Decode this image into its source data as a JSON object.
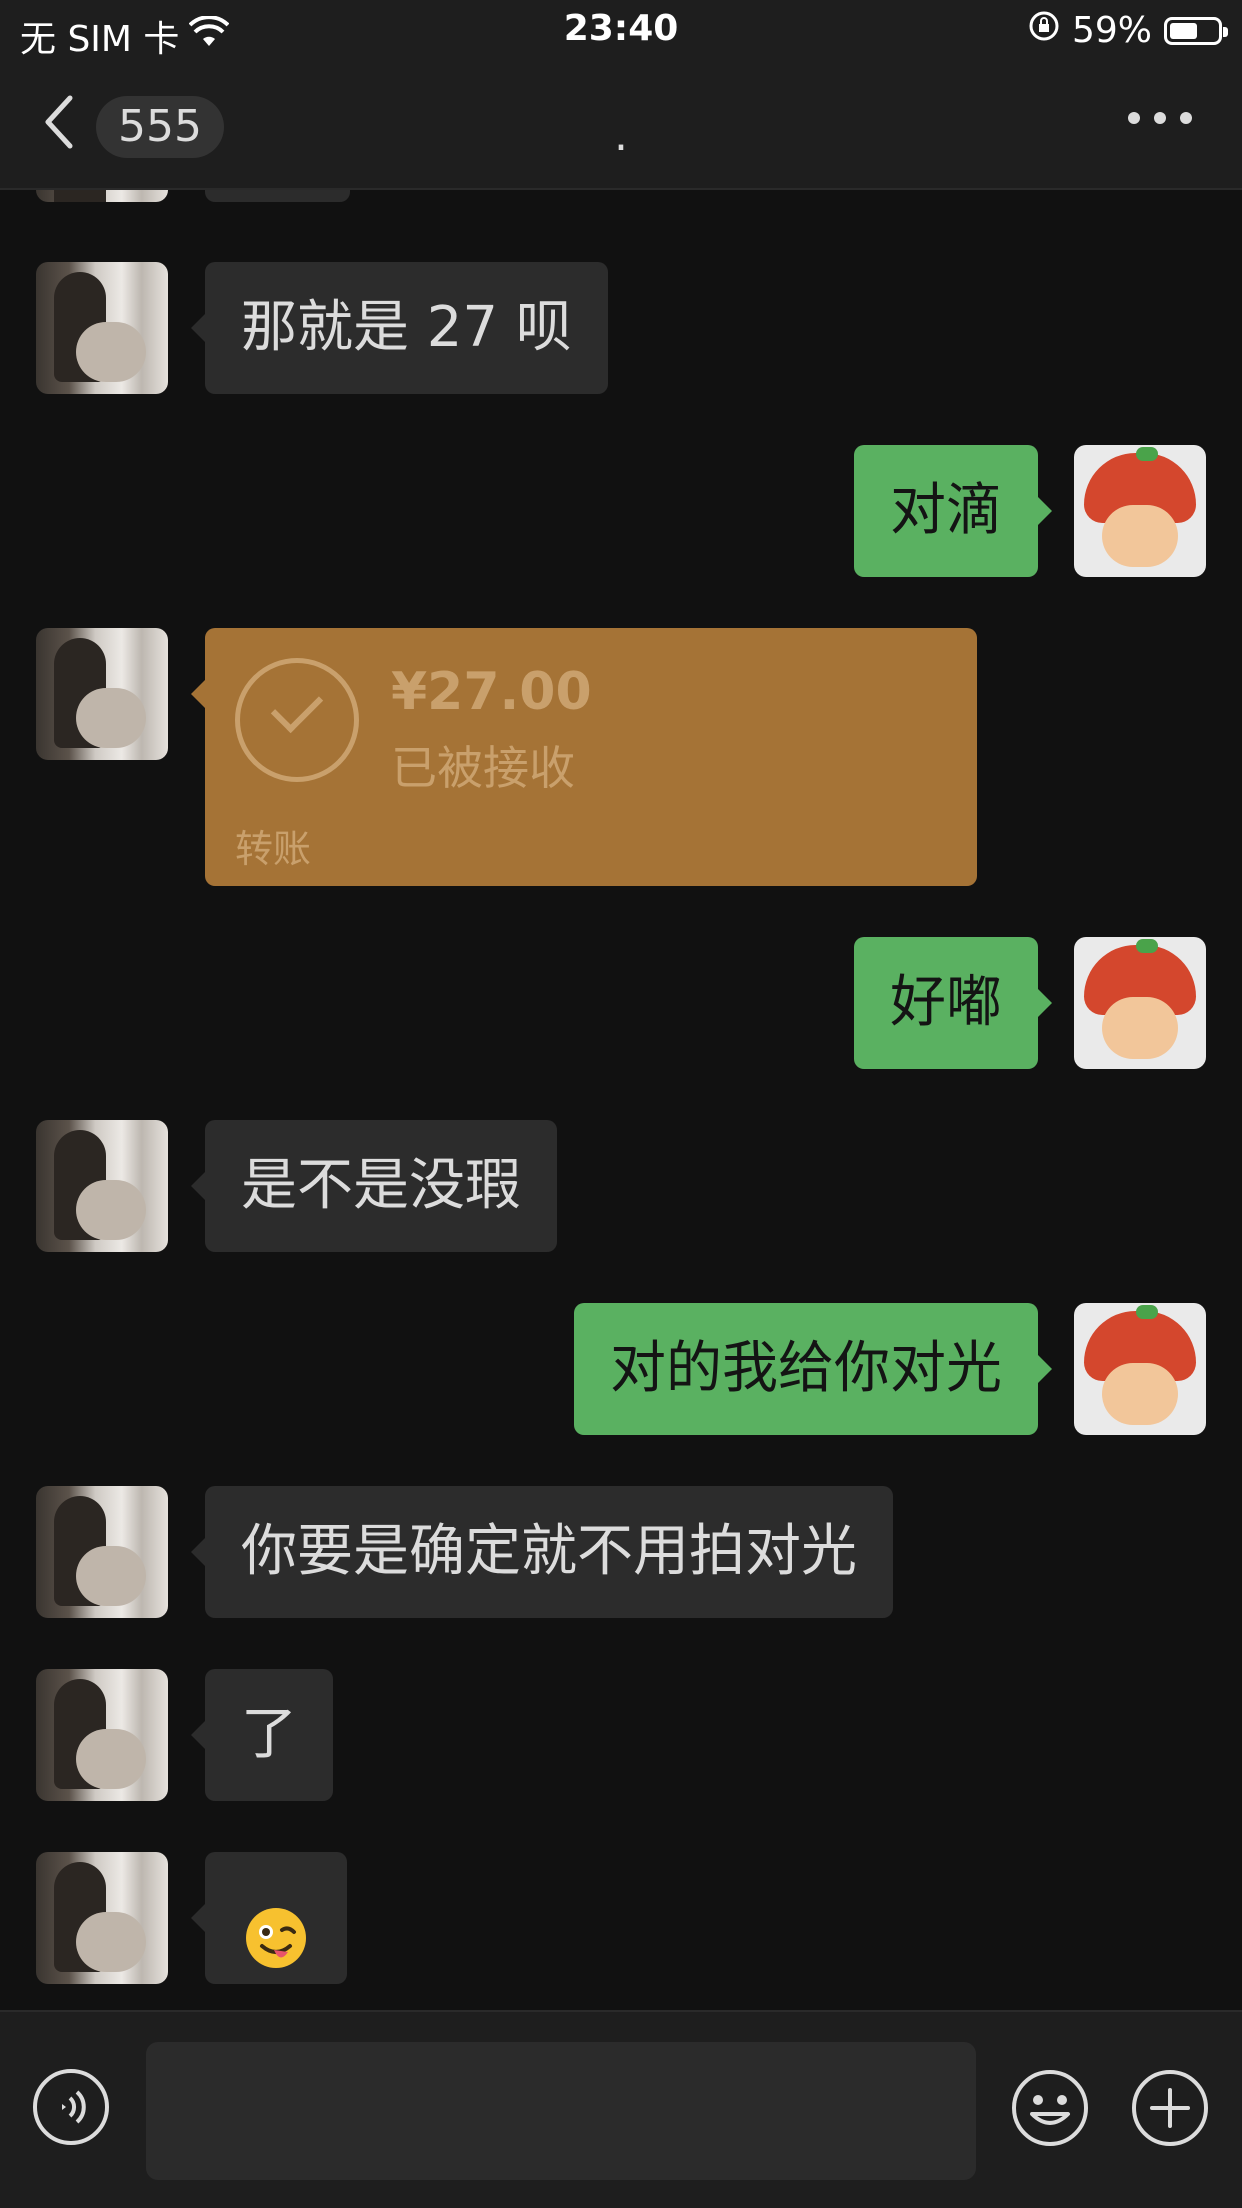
{
  "status_bar": {
    "carrier": "无 SIM 卡",
    "time": "23:40",
    "battery_percent": "59%",
    "battery_level": 0.59
  },
  "nav": {
    "unread_count": "555",
    "title": "."
  },
  "messages": [
    {
      "side": "in",
      "text": "那就是 27 呗"
    },
    {
      "side": "out",
      "text": "对滴"
    },
    {
      "side": "in",
      "type": "transfer",
      "amount": "¥27.00",
      "status": "已被接收",
      "label": "转账"
    },
    {
      "side": "out",
      "text": "好嘟"
    },
    {
      "side": "in",
      "text": "是不是没瑕"
    },
    {
      "side": "out",
      "text": "对的我给你对光"
    },
    {
      "side": "in",
      "text": "你要是确定就不用拍对光"
    },
    {
      "side": "in",
      "text": "了"
    },
    {
      "side": "in",
      "type": "emoji",
      "emoji": "winking-face-with-tongue"
    }
  ],
  "colors": {
    "background": "#111111",
    "bar": "#1e1e1e",
    "incoming_bubble": "#2c2c2c",
    "outgoing_bubble": "#5ab161",
    "transfer_card": "#a57336"
  },
  "icons": {
    "back": "chevron-left-icon",
    "more": "more-dots-icon",
    "voice": "voice-icon",
    "emoji": "smiley-icon",
    "plus": "plus-icon",
    "wifi": "wifi-icon",
    "lock": "orientation-lock-icon"
  }
}
